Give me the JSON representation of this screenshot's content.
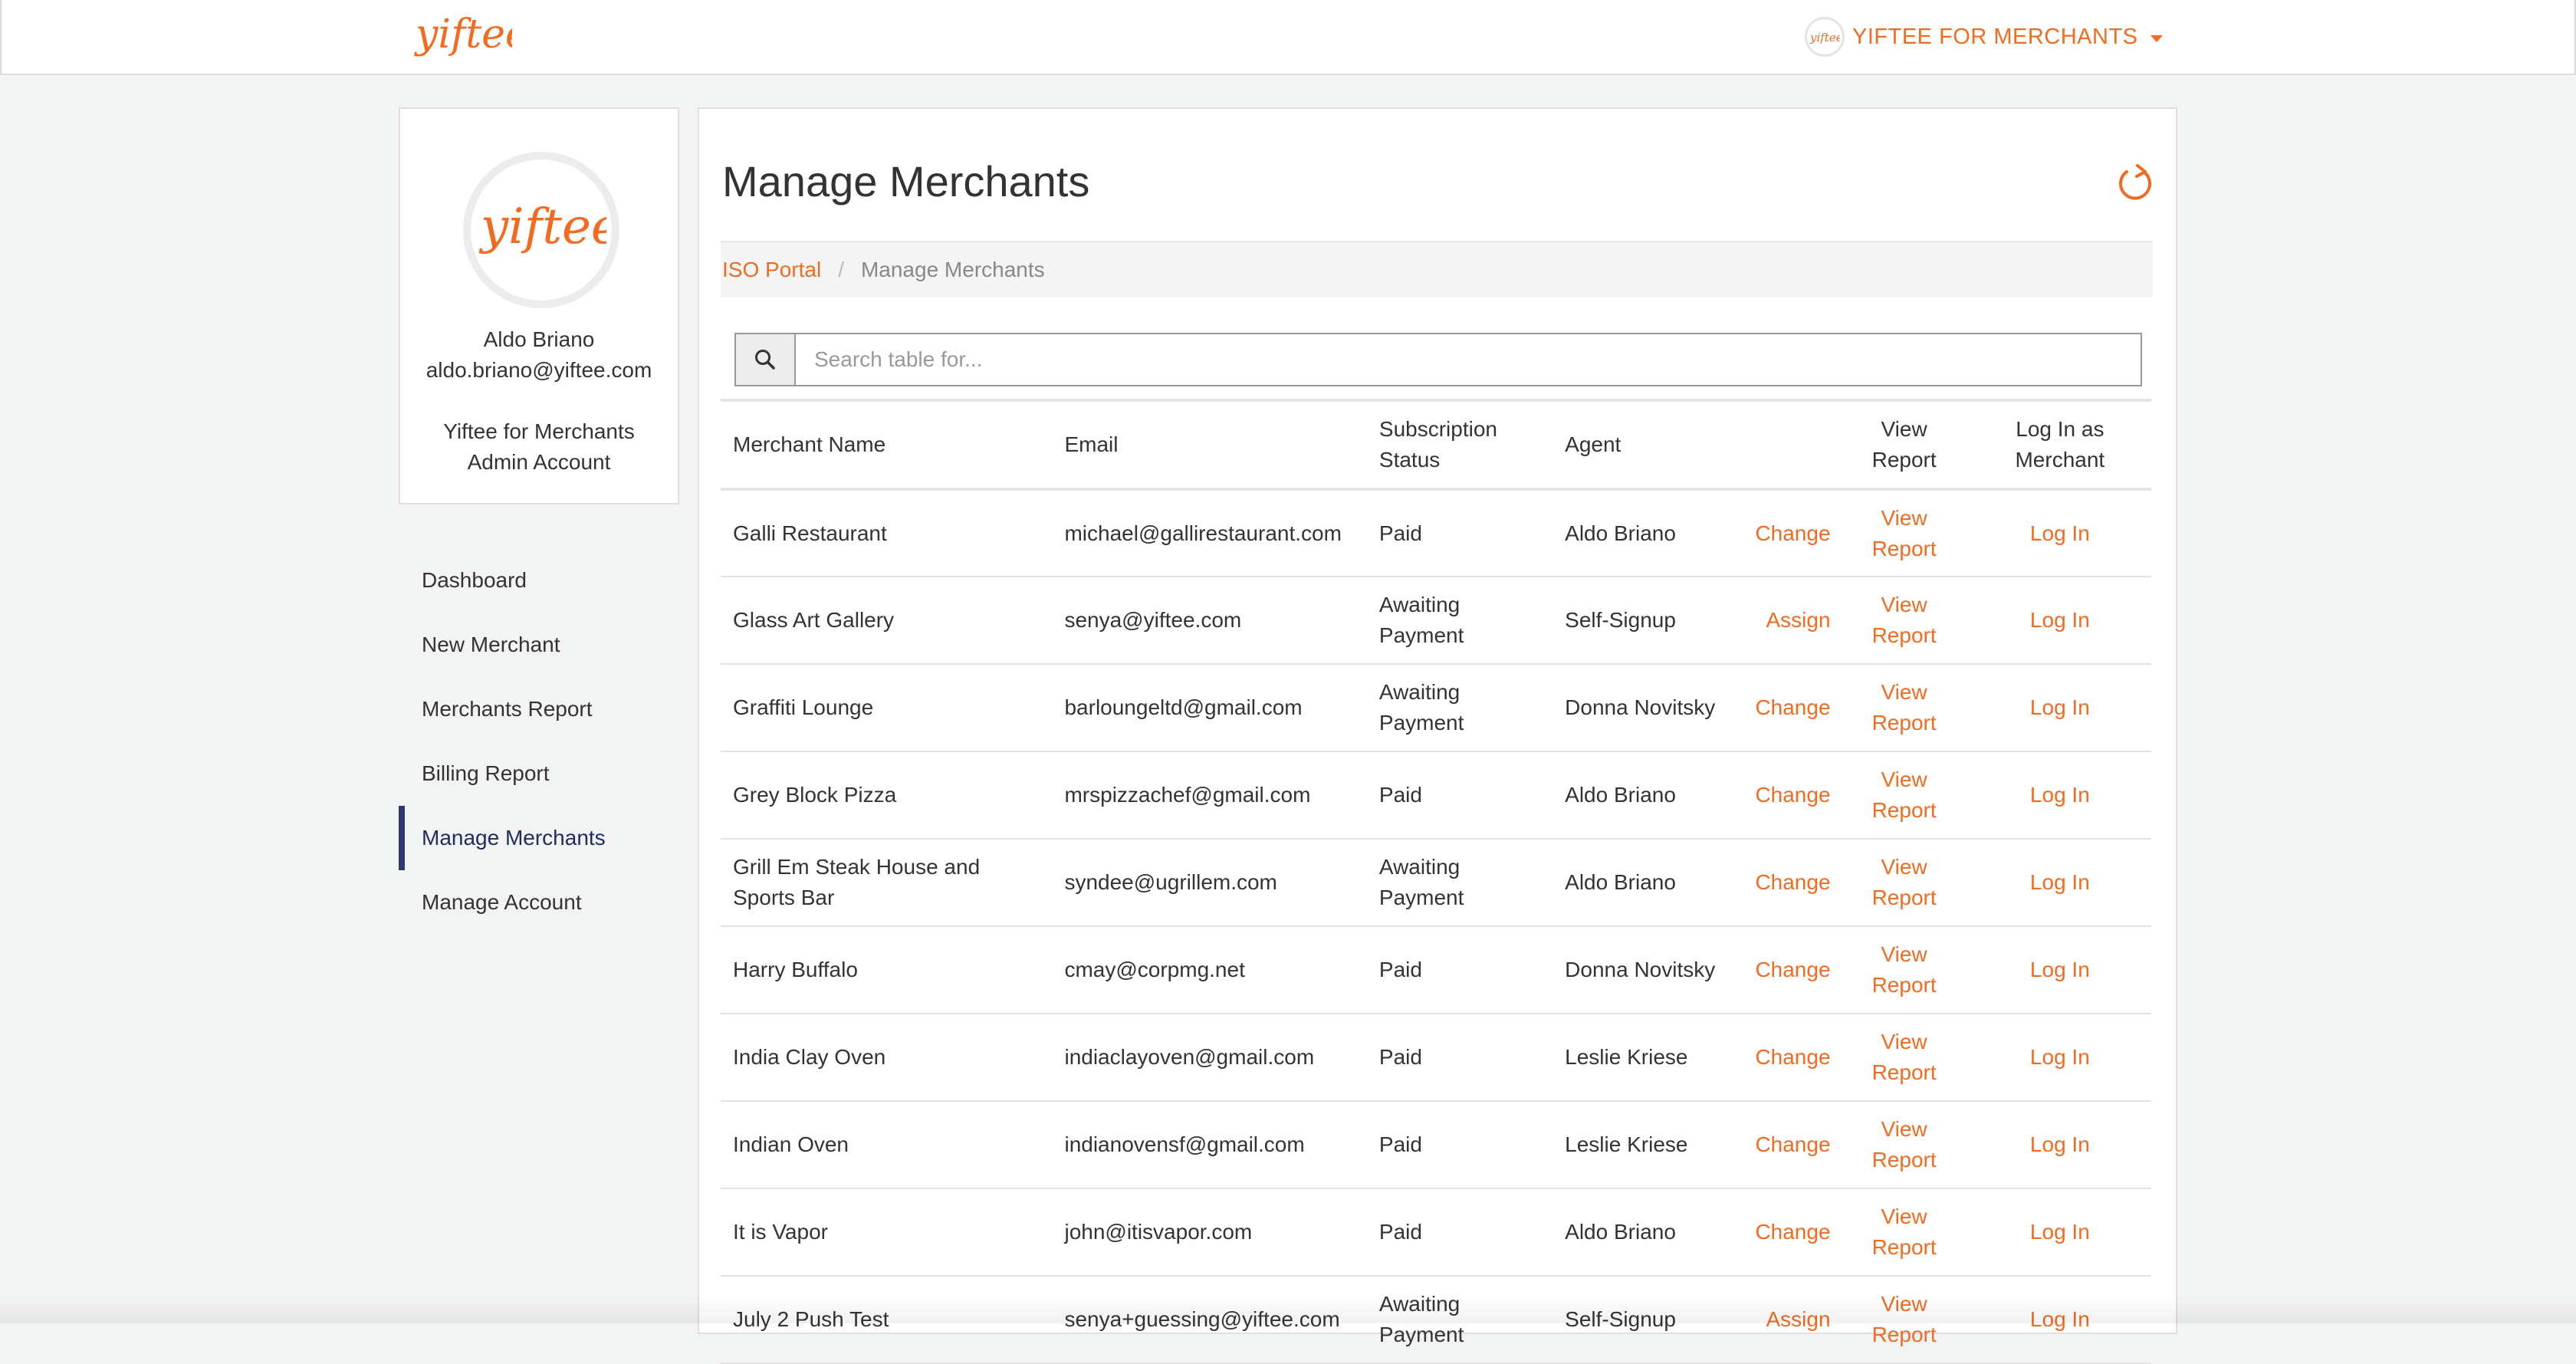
{
  "brand": {
    "logo_text": "yiftee",
    "account_menu_label": "YIFTEE FOR MERCHANTS",
    "accent_color": "#f26b21",
    "active_nav_color": "#2b3a6b"
  },
  "profile": {
    "name": "Aldo Briano",
    "email": "aldo.briano@yiftee.com",
    "organization": "Yiftee for Merchants",
    "role": "Admin Account"
  },
  "sidebar": {
    "items": [
      {
        "label": "Dashboard",
        "active": false
      },
      {
        "label": "New Merchant",
        "active": false
      },
      {
        "label": "Merchants Report",
        "active": false
      },
      {
        "label": "Billing Report",
        "active": false
      },
      {
        "label": "Manage Merchants",
        "active": true
      },
      {
        "label": "Manage Account",
        "active": false
      }
    ]
  },
  "main": {
    "title": "Manage Merchants",
    "breadcrumb": {
      "parent": "ISO Portal",
      "separator": "/",
      "current": "Manage Merchants"
    },
    "search": {
      "placeholder": "Search table for..."
    },
    "table": {
      "headers": {
        "name": "Merchant Name",
        "email": "Email",
        "status_line1": "Subscription",
        "status_line2": "Status",
        "agent": "Agent",
        "report_line1": "View",
        "report_line2": "Report",
        "login_line1": "Log In as",
        "login_line2": "Merchant"
      },
      "rows": [
        {
          "name": "Galli Restaurant",
          "email": "michael@gallirestaurant.com",
          "status": "Paid",
          "agent": "Aldo Briano",
          "action": "Change",
          "report": "View Report",
          "login": "Log In"
        },
        {
          "name": "Glass Art Gallery",
          "email": "senya@yiftee.com",
          "status": "Awaiting Payment",
          "agent": "Self-Signup",
          "action": "Assign",
          "report": "View Report",
          "login": "Log In"
        },
        {
          "name": "Graffiti Lounge",
          "email": "barloungeltd@gmail.com",
          "status": "Awaiting Payment",
          "agent": "Donna Novitsky",
          "action": "Change",
          "report": "View Report",
          "login": "Log In"
        },
        {
          "name": "Grey Block Pizza",
          "email": "mrspizzachef@gmail.com",
          "status": "Paid",
          "agent": "Aldo Briano",
          "action": "Change",
          "report": "View Report",
          "login": "Log In"
        },
        {
          "name": "Grill Em Steak House and Sports Bar",
          "email": "syndee@ugrillem.com",
          "status": "Awaiting Payment",
          "agent": "Aldo Briano",
          "action": "Change",
          "report": "View Report",
          "login": "Log In"
        },
        {
          "name": "Harry Buffalo",
          "email": "cmay@corpmg.net",
          "status": "Paid",
          "agent": "Donna Novitsky",
          "action": "Change",
          "report": "View Report",
          "login": "Log In"
        },
        {
          "name": "India Clay Oven",
          "email": "indiaclayoven@gmail.com",
          "status": "Paid",
          "agent": "Leslie Kriese",
          "action": "Change",
          "report": "View Report",
          "login": "Log In"
        },
        {
          "name": "Indian Oven",
          "email": "indianovensf@gmail.com",
          "status": "Paid",
          "agent": "Leslie Kriese",
          "action": "Change",
          "report": "View Report",
          "login": "Log In"
        },
        {
          "name": "It is Vapor",
          "email": "john@itisvapor.com",
          "status": "Paid",
          "agent": "Aldo Briano",
          "action": "Change",
          "report": "View Report",
          "login": "Log In"
        },
        {
          "name": "July 2 Push Test",
          "email": "senya+guessing@yiftee.com",
          "status": "Awaiting Payment",
          "agent": "Self-Signup",
          "action": "Assign",
          "report": "View Report",
          "login": "Log In"
        }
      ]
    }
  }
}
